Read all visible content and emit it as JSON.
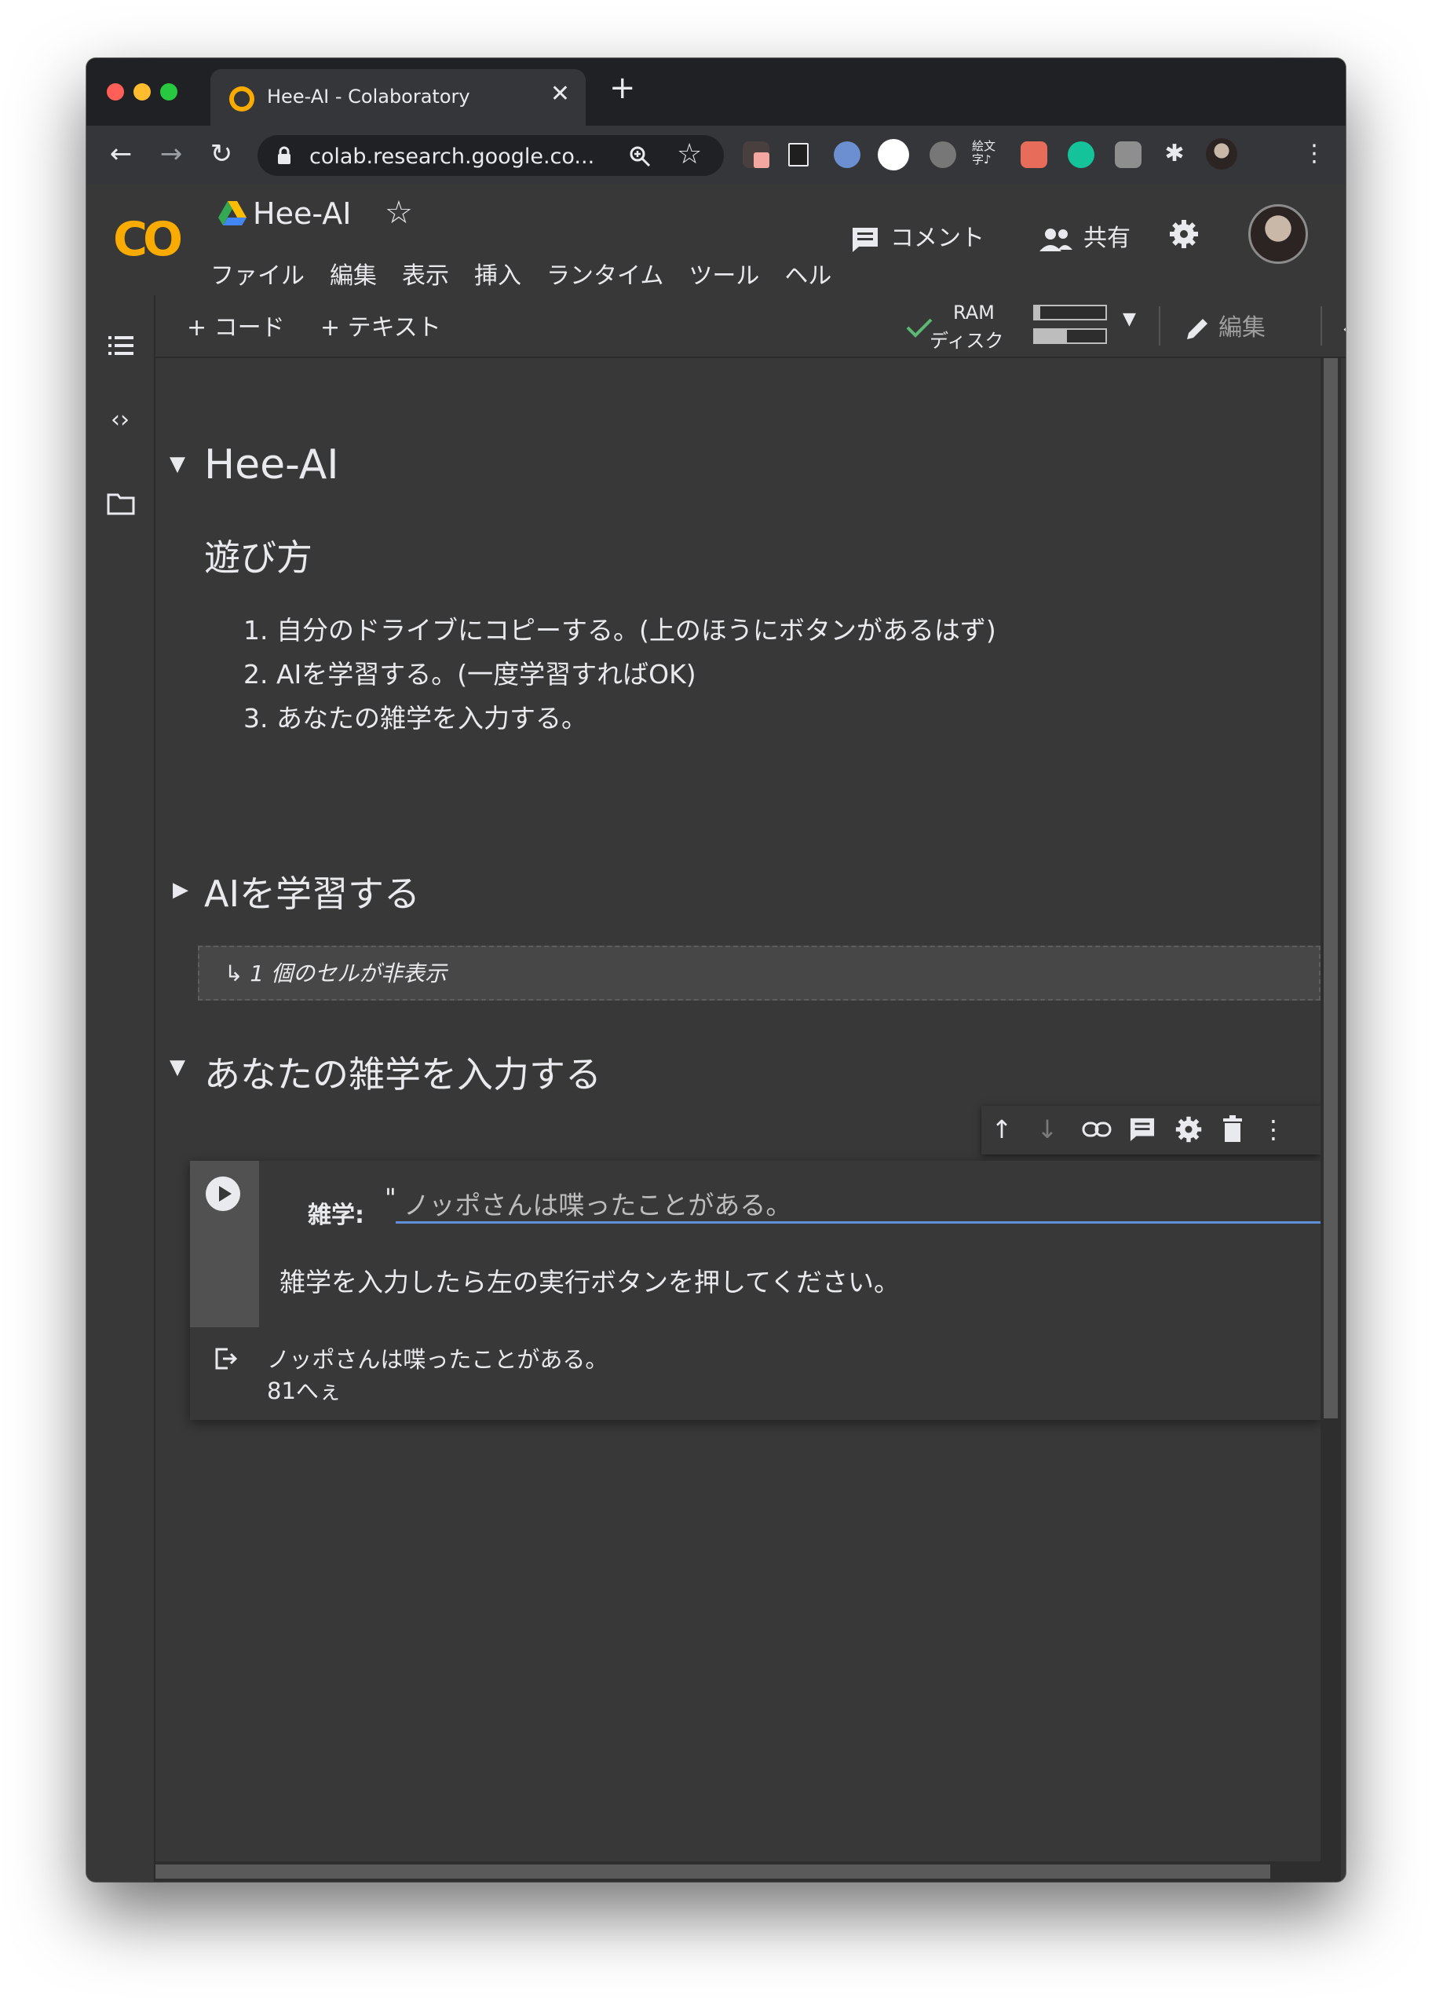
{
  "browser": {
    "tab_title": "Hee-AI - Colaboratory",
    "tab_close": "✕",
    "new_tab": "+",
    "url": "colab.research.google.co...",
    "ext_label_1": "絵文字♪"
  },
  "colab": {
    "logo": "CO",
    "notebook_title": "Hee-AI",
    "menu": [
      "ファイル",
      "編集",
      "表示",
      "挿入",
      "ランタイム",
      "ツール",
      "ヘル"
    ],
    "comment": "コメント",
    "share": "共有",
    "add_code": "+ コード",
    "add_text": "+ テキスト",
    "ram_label": "RAM",
    "disk_label": "ディスク",
    "ram_usage": 0.08,
    "disk_usage": 0.45,
    "edit": "編集"
  },
  "notebook": {
    "title": "Hee-AI",
    "subtitle": "遊び方",
    "steps": [
      "1. 自分のドライブにコピーする。(上のほうにボタンがあるはず)",
      "2. AIを学習する。(一度学習すればOK)",
      "3. あなたの雑学を入力する。"
    ],
    "section_train": "AIを学習する",
    "hidden_cells": "↳ 1 個のセルが非表示",
    "section_input": "あなたの雑学を入力する",
    "form_label": "雑学:",
    "form_quote": "\"",
    "form_value": "ノッポさんは喋ったことがある。",
    "cell_desc": "雑学を入力したら左の実行ボタンを押してください。",
    "output": [
      "ノッポさんは喋ったことがある。",
      "81へぇ"
    ]
  },
  "colors": {
    "accent": "#f9ab00",
    "input_underline": "#5f8fd6",
    "check": "#5bb974"
  }
}
